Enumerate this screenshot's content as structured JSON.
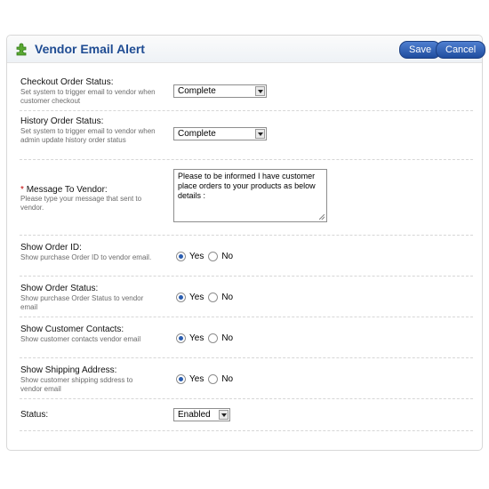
{
  "header": {
    "title": "Vendor Email Alert",
    "icon": "puzzle-icon",
    "save_label": "Save",
    "cancel_label": "Cancel"
  },
  "colors": {
    "title": "#1f4c93",
    "button": "#2a5db0",
    "required": "#c00000"
  },
  "fields": {
    "checkout_order_status": {
      "label": "Checkout Order Status:",
      "help": "Set system to trigger email to vendor when customer checkout",
      "value": "Complete"
    },
    "history_order_status": {
      "label": "History Order Status:",
      "help": "Set system to trigger email to vendor when admin update history order status",
      "value": "Complete"
    },
    "message_to_vendor": {
      "required_mark": "*",
      "label": "Message To Vendor:",
      "help": "Please type your message that sent to vendor.",
      "value": "Please to be informed I have customer place orders to your products as below details :"
    },
    "show_order_id": {
      "label": "Show Order ID:",
      "help": "Show purchase Order ID to vendor email.",
      "yes": "Yes",
      "no": "No",
      "selected": "Yes"
    },
    "show_order_status": {
      "label": "Show Order Status:",
      "help": "Show purchase Order Status to vendor email",
      "yes": "Yes",
      "no": "No",
      "selected": "Yes"
    },
    "show_customer_contacts": {
      "label": "Show Customer Contacts:",
      "help": "Show customer contacts vendor email",
      "yes": "Yes",
      "no": "No",
      "selected": "Yes"
    },
    "show_shipping_address": {
      "label": "Show Shipping Address:",
      "help": "Show customer shipping sddress to vendor email",
      "yes": "Yes",
      "no": "No",
      "selected": "Yes"
    },
    "status": {
      "label": "Status:",
      "value": "Enabled"
    }
  }
}
